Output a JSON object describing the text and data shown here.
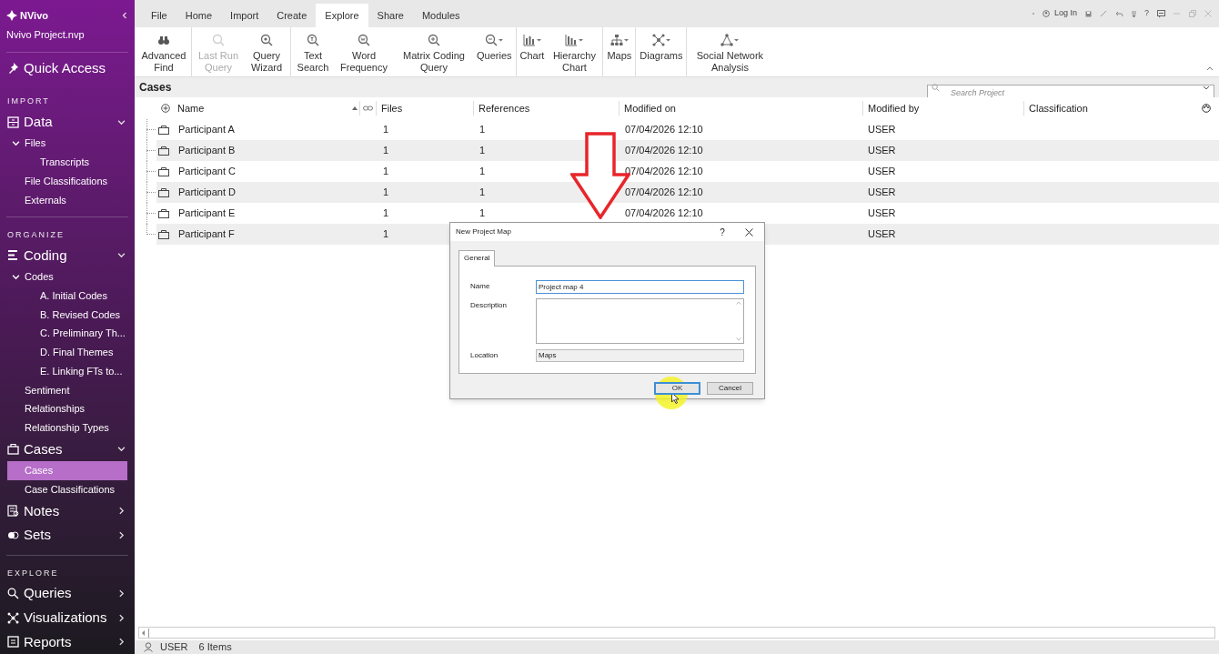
{
  "sidebar": {
    "app_name": "NVivo",
    "project": "Nvivo Project.nvp",
    "quick_access": "Quick Access",
    "sections": [
      {
        "title": "IMPORT",
        "groups": [
          {
            "label": "Data",
            "expanded": true,
            "children": [
              {
                "label": "Files",
                "selected": false,
                "expanded": true,
                "children": [
                  {
                    "label": "Transcripts",
                    "selected": false
                  }
                ]
              },
              {
                "label": "File Classifications",
                "selected": false
              },
              {
                "label": "Externals",
                "selected": false
              }
            ]
          }
        ]
      },
      {
        "title": "ORGANIZE",
        "groups": [
          {
            "label": "Coding",
            "expanded": true,
            "children": [
              {
                "label": "Codes",
                "selected": false,
                "expanded": true,
                "children": [
                  {
                    "label": "A. Initial Codes",
                    "selected": false
                  },
                  {
                    "label": "B. Revised Codes",
                    "selected": false
                  },
                  {
                    "label": "C. Preliminary Th...",
                    "selected": false
                  },
                  {
                    "label": "D. Final Themes",
                    "selected": false
                  },
                  {
                    "label": "E. Linking FTs to...",
                    "selected": false
                  }
                ]
              },
              {
                "label": "Sentiment",
                "selected": false
              },
              {
                "label": "Relationships",
                "selected": false
              },
              {
                "label": "Relationship Types",
                "selected": false
              }
            ]
          },
          {
            "label": "Cases",
            "expanded": true,
            "children": [
              {
                "label": "Cases",
                "selected": true
              },
              {
                "label": "Case Classifications",
                "selected": false
              }
            ]
          },
          {
            "label": "Notes",
            "expanded": false
          },
          {
            "label": "Sets",
            "expanded": false
          }
        ]
      },
      {
        "title": "EXPLORE",
        "groups": [
          {
            "label": "Queries",
            "expanded": false
          },
          {
            "label": "Visualizations",
            "expanded": false
          },
          {
            "label": "Reports",
            "expanded": false
          }
        ]
      }
    ]
  },
  "menu_tabs": [
    {
      "label": "File",
      "selected": false
    },
    {
      "label": "Home",
      "selected": false
    },
    {
      "label": "Import",
      "selected": false
    },
    {
      "label": "Create",
      "selected": false
    },
    {
      "label": "Explore",
      "selected": true
    },
    {
      "label": "Share",
      "selected": false
    },
    {
      "label": "Modules",
      "selected": false
    }
  ],
  "title_bar": {
    "login": "Log In",
    "help": "?"
  },
  "ribbon": [
    [
      {
        "label": "Advanced Find",
        "disabled": false,
        "dropdown": false
      }
    ],
    [
      {
        "label": "Last Run Query",
        "disabled": true,
        "dropdown": false
      },
      {
        "label": "Query Wizard",
        "disabled": false,
        "dropdown": false
      }
    ],
    [
      {
        "label": "Text Search",
        "disabled": false,
        "dropdown": false
      },
      {
        "label": "Word Frequency",
        "disabled": false,
        "dropdown": false
      },
      {
        "label": "Matrix Coding Query",
        "disabled": false,
        "dropdown": false
      },
      {
        "label": "Queries",
        "disabled": false,
        "dropdown": true
      }
    ],
    [
      {
        "label": "Chart",
        "disabled": false,
        "dropdown": true
      },
      {
        "label": "Hierarchy Chart",
        "disabled": false,
        "dropdown": true
      }
    ],
    [
      {
        "label": "Maps",
        "disabled": false,
        "dropdown": true
      }
    ],
    [
      {
        "label": "Diagrams",
        "disabled": false,
        "dropdown": true
      }
    ],
    [
      {
        "label": "Social Network Analysis",
        "disabled": false,
        "dropdown": true
      }
    ]
  ],
  "list_title": "Cases",
  "search": {
    "placeholder": "Search Project"
  },
  "table": {
    "columns": [
      "Name",
      "Files",
      "References",
      "Modified on",
      "Modified by",
      "Classification"
    ],
    "rows": [
      {
        "name": "Participant A",
        "files": "1",
        "references": "1",
        "modified_on": "07/04/2026 12:10",
        "modified_by": "USER"
      },
      {
        "name": "Participant B",
        "files": "1",
        "references": "1",
        "modified_on": "07/04/2026 12:10",
        "modified_by": "USER"
      },
      {
        "name": "Participant C",
        "files": "1",
        "references": "1",
        "modified_on": "07/04/2026 12:10",
        "modified_by": "USER"
      },
      {
        "name": "Participant D",
        "files": "1",
        "references": "1",
        "modified_on": "07/04/2026 12:10",
        "modified_by": "USER"
      },
      {
        "name": "Participant E",
        "files": "1",
        "references": "1",
        "modified_on": "07/04/2026 12:10",
        "modified_by": "USER"
      },
      {
        "name": "Participant F",
        "files": "1",
        "modified_by": "USER"
      }
    ]
  },
  "dialog": {
    "title": "New Project Map",
    "help": "?",
    "tab": "General",
    "name_label": "Name",
    "name_value": "Project map 4",
    "description_label": "Description",
    "location_label": "Location",
    "location_value": "Maps",
    "ok": "OK",
    "cancel": "Cancel"
  },
  "status_bar": {
    "user": "USER",
    "items": "6 Items"
  }
}
